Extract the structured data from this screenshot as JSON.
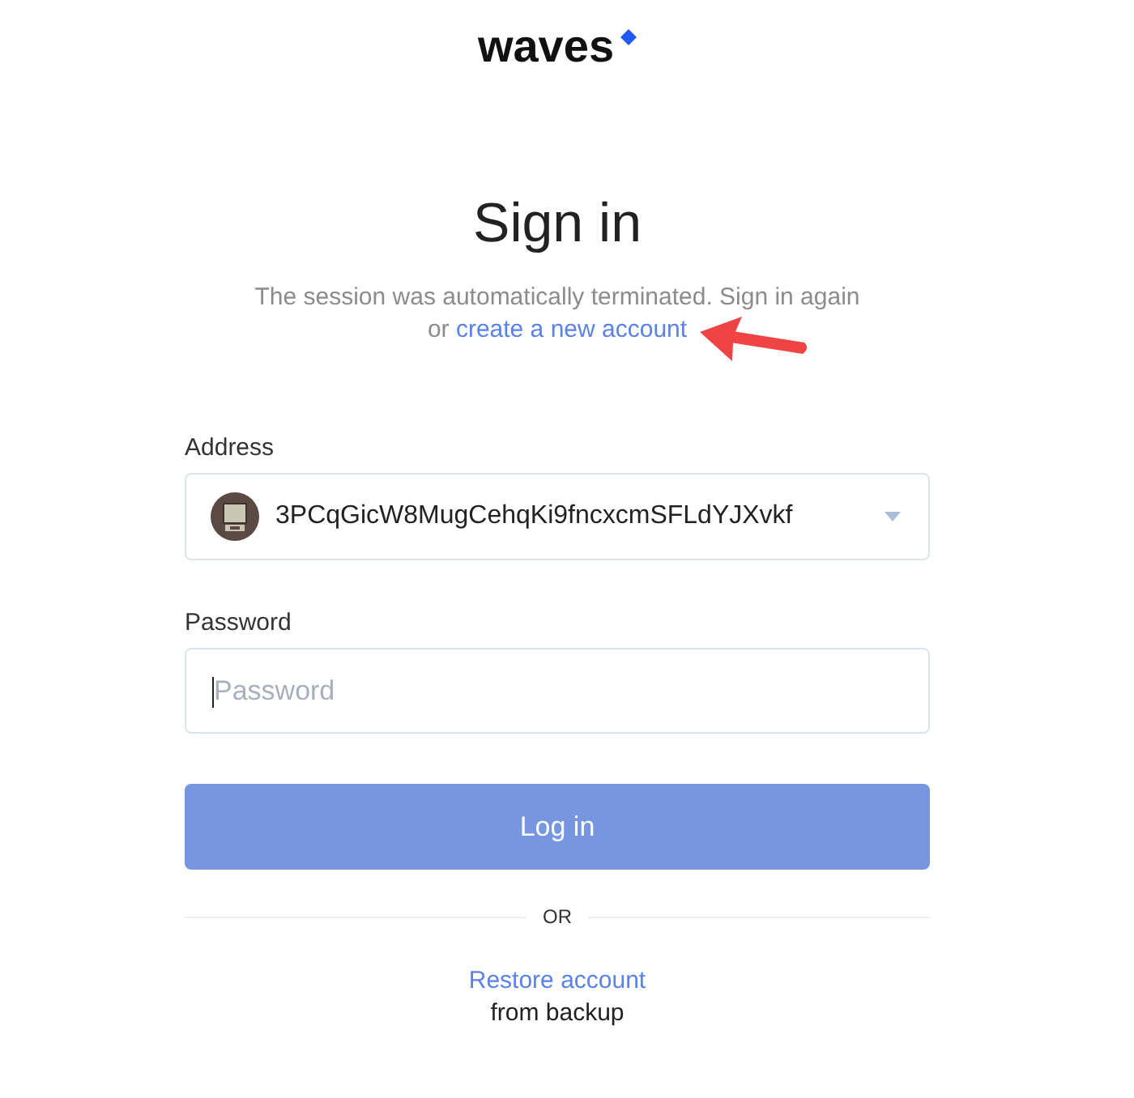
{
  "logo": {
    "text": "waves"
  },
  "heading": "Sign in",
  "message": {
    "text": "The session was automatically terminated. Sign in again",
    "link_prefix": "or",
    "link": "create a new account",
    "arrow": true
  },
  "address": {
    "label": "Address",
    "value": "3PCqGicW8MugCehqKi9fncxcmSFLdYJXvkf"
  },
  "password": {
    "label": "Password",
    "placeholder": "Password",
    "focused": true
  },
  "login_button": {
    "label": "Log in",
    "disabled": true
  },
  "divider": {
    "text": "OR"
  },
  "restore": {
    "link": "Restore account",
    "text": "from backup"
  }
}
